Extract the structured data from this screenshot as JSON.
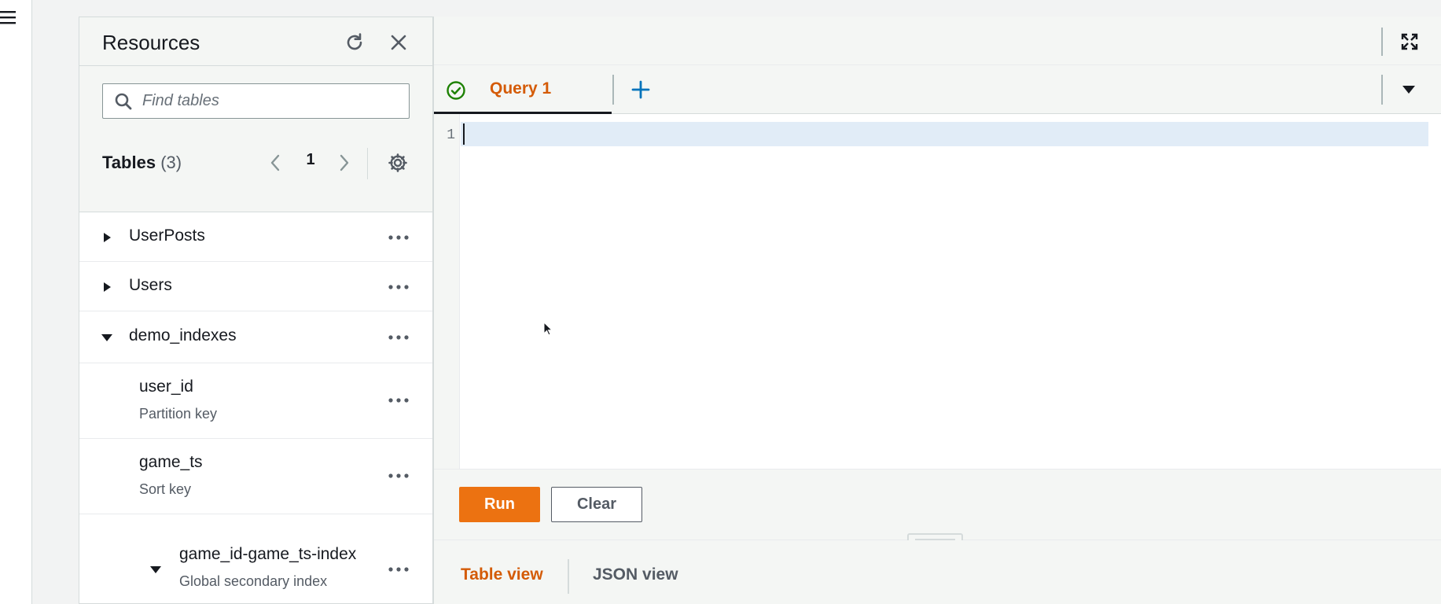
{
  "resources": {
    "title": "Resources",
    "search": {
      "placeholder": "Find tables",
      "value": ""
    },
    "tables": {
      "label": "Tables",
      "count": "(3)",
      "page": "1"
    },
    "tree": [
      {
        "label": "UserPosts",
        "expanded": false
      },
      {
        "label": "Users",
        "expanded": false
      },
      {
        "label": "demo_indexes",
        "expanded": true,
        "children": [
          {
            "label": "user_id",
            "sub": "Partition key"
          },
          {
            "label": "game_ts",
            "sub": "Sort key"
          },
          {
            "label": "game_id-game_ts-index",
            "sub": "Global secondary index",
            "expanded": true
          }
        ]
      }
    ]
  },
  "editor": {
    "tabs": [
      {
        "label": "Query 1",
        "status": "check-circle-icon",
        "active": true
      }
    ],
    "lines": [
      "1"
    ],
    "code": ""
  },
  "actions": {
    "run_label": "Run",
    "clear_label": "Clear"
  },
  "result_views": {
    "table_label": "Table view",
    "json_label": "JSON view",
    "active": "Table view"
  },
  "colors": {
    "accent_orange": "#ec7211",
    "tab_orange": "#d45b07",
    "success_green": "#1d8102",
    "link_blue": "#0073bb",
    "active_line_bg": "#e1ecf7"
  }
}
